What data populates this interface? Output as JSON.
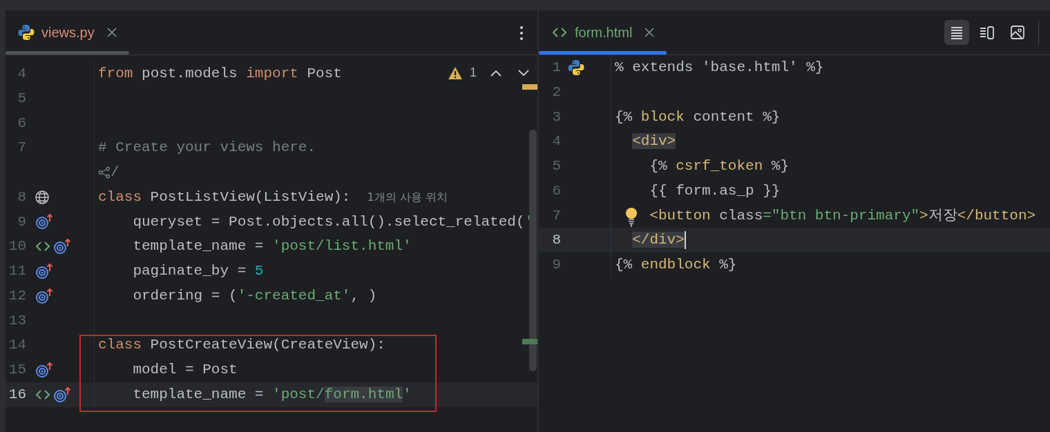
{
  "left_pane": {
    "tab": {
      "label": "views.py",
      "color": "#d98c7b",
      "selected": false
    },
    "problems": {
      "count": "1"
    },
    "lines": [
      {
        "number": "4",
        "tokens": [
          {
            "kind": "kw",
            "text": "from"
          },
          {
            "kind": "plain",
            "text": " post.models "
          },
          {
            "kind": "kw",
            "text": "import"
          },
          {
            "kind": "plain",
            "text": " Post"
          }
        ]
      },
      {
        "number": "5"
      },
      {
        "number": "6"
      },
      {
        "number": "7",
        "tokens": [
          {
            "kind": "comment",
            "text": "# Create your views here."
          }
        ]
      },
      {
        "kind": "vision",
        "tokens": [
          {
            "kind": "comment",
            "text": "/"
          }
        ]
      },
      {
        "number": "8",
        "gutter": [
          {
            "kind": "globe"
          }
        ],
        "tokens": [
          {
            "kind": "kw",
            "text": "class"
          },
          {
            "kind": "plain",
            "text": " PostListView(ListView):"
          },
          {
            "kind": "hint",
            "text": "1개의 사용 위치"
          }
        ]
      },
      {
        "number": "9",
        "gutter": [
          {
            "kind": "override"
          }
        ],
        "tokens": [
          {
            "kind": "plain",
            "text": "    queryset = Post.objects.all().select_related("
          },
          {
            "kind": "str",
            "text": "'"
          }
        ]
      },
      {
        "number": "10",
        "gutter": [
          {
            "kind": "html"
          },
          {
            "kind": "override"
          }
        ],
        "tokens": [
          {
            "kind": "plain",
            "text": "    template_name = "
          },
          {
            "kind": "str",
            "text": "'post/list.html'"
          }
        ]
      },
      {
        "number": "11",
        "gutter": [
          {
            "kind": "override"
          }
        ],
        "tokens": [
          {
            "kind": "plain",
            "text": "    paginate_by = "
          },
          {
            "kind": "num",
            "text": "5"
          }
        ]
      },
      {
        "number": "12",
        "gutter": [
          {
            "kind": "override"
          }
        ],
        "tokens": [
          {
            "kind": "plain",
            "text": "    ordering = ("
          },
          {
            "kind": "str",
            "text": "'-created_at'"
          },
          {
            "kind": "plain",
            "text": ", )"
          }
        ]
      },
      {
        "number": "13"
      },
      {
        "number": "14",
        "framed": true,
        "tokens": [
          {
            "kind": "kw",
            "text": "class"
          },
          {
            "kind": "plain",
            "text": " PostCreateView(CreateView):"
          }
        ]
      },
      {
        "number": "15",
        "gutter": [
          {
            "kind": "override"
          }
        ],
        "framed": true,
        "tokens": [
          {
            "kind": "plain",
            "text": "    model = Post"
          }
        ]
      },
      {
        "number": "16",
        "gutter": [
          {
            "kind": "html"
          },
          {
            "kind": "override"
          }
        ],
        "framed": true,
        "current": true,
        "tokens": [
          {
            "kind": "plain",
            "text": "    template_name = "
          },
          {
            "kind": "str",
            "text": "'post/"
          },
          {
            "kind": "str",
            "text": "form.html",
            "highlight": true
          },
          {
            "kind": "str",
            "text": "'"
          }
        ]
      }
    ]
  },
  "right_pane": {
    "tab": {
      "label": "form.html",
      "color": "#6aab73",
      "selected": true
    },
    "view_modes": [
      {
        "kind": "editor",
        "selected": true
      },
      {
        "kind": "split",
        "selected": false
      },
      {
        "kind": "preview",
        "selected": false
      }
    ],
    "lines": [
      {
        "number": "1",
        "gutter": [
          {
            "kind": "python"
          }
        ],
        "tokens": [
          {
            "kind": "plain",
            "text": "% extends 'base.html' %}"
          }
        ]
      },
      {
        "number": "2"
      },
      {
        "number": "3",
        "tokens": [
          {
            "kind": "plain",
            "text": "{% "
          },
          {
            "kind": "tag",
            "text": "block"
          },
          {
            "kind": "plain",
            "text": " content %}"
          }
        ]
      },
      {
        "number": "4",
        "indented": true,
        "tokens": [
          {
            "kind": "tag",
            "text": "<div>",
            "highlight": true
          }
        ]
      },
      {
        "number": "5",
        "tokens": [
          {
            "kind": "plain",
            "text": "    {% "
          },
          {
            "kind": "tag",
            "text": "csrf_token"
          },
          {
            "kind": "plain",
            "text": " %}"
          }
        ]
      },
      {
        "number": "6",
        "tokens": [
          {
            "kind": "plain",
            "text": "    {{ form.as_p }}"
          }
        ]
      },
      {
        "number": "7",
        "intention": true,
        "tokens": [
          {
            "kind": "tag",
            "text": "    <button"
          },
          {
            "kind": "plain",
            "text": " class"
          },
          {
            "kind": "str",
            "text": "=\"btn btn-primary\""
          },
          {
            "kind": "tag",
            "text": ">"
          },
          {
            "kind": "plain",
            "text": "저장"
          },
          {
            "kind": "tag",
            "text": "</button>"
          }
        ]
      },
      {
        "number": "8",
        "indented": true,
        "current": true,
        "caret": true,
        "tokens": [
          {
            "kind": "tag",
            "text": "</div>",
            "highlight": true
          }
        ]
      },
      {
        "number": "9",
        "tokens": [
          {
            "kind": "plain",
            "text": "{% "
          },
          {
            "kind": "tag",
            "text": "endblock"
          },
          {
            "kind": "plain",
            "text": " %}"
          }
        ]
      }
    ]
  }
}
